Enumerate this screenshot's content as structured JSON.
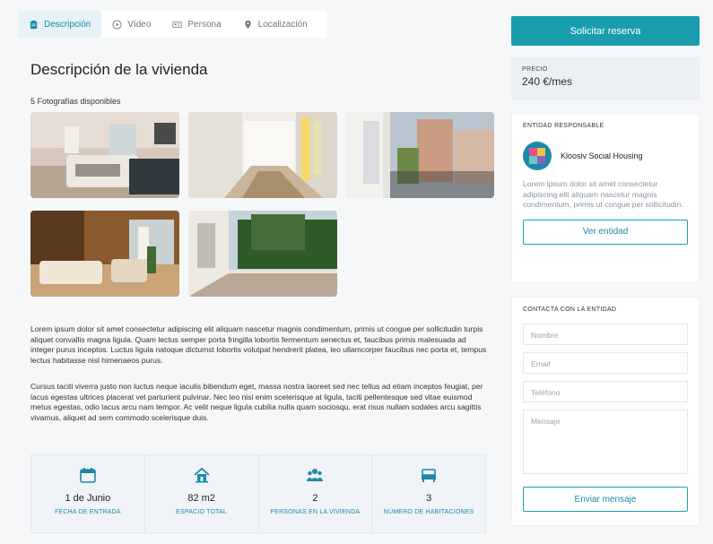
{
  "tabs": [
    {
      "label": "Descripción",
      "icon": "clipboard-icon",
      "active": true
    },
    {
      "label": "Vídeo",
      "icon": "play-icon",
      "active": false
    },
    {
      "label": "Persona",
      "icon": "id-card-icon",
      "active": false
    },
    {
      "label": "Localización",
      "icon": "map-pin-icon",
      "active": false
    }
  ],
  "main": {
    "title": "Descripción de la vivienda",
    "photos_count": "5 Fotografías disponibles",
    "paragraph1": "Lorem ipsum dolor sit amet consectetur adipiscing elit aliquam nascetur magnis condimentum, primis ut congue per sollicitudin turpis aliquet convallis magna ligula. Quam lectus semper porta fringilla lobortis fermentum senectus et, faucibus primis malesuada ad integer purus inceptos. Luctus ligula natoque dictumst lobortis volutpat hendrerit platea, leo ullamcorper faucibus nec porta et, tempus lectus habitasse nisl himenaeos purus.",
    "paragraph2": "Cursus taciti viverra justo non luctus neque iaculis bibendum eget, massa nostra laoreet sed nec tellus ad etiam inceptos feugiat, per lacus egestas ultrices placerat vel parturient pulvinar. Nec leo nisi enim scelerisque at ligula, taciti pellentesque sed vitae euismod metus egestas, odio lacus arcu nam tempor. Ac velit neque ligula cubilia nulla quam sociosqu, erat risus nullam sodales arcu sagittis vivamus, aliquet ad sem commodo scelerisque duis."
  },
  "stats": [
    {
      "value": "1 de Junio",
      "label": "FECHA DE ENTRADA",
      "icon": "calendar-icon"
    },
    {
      "value": "82 m2",
      "label": "ESPACIO TOTAL",
      "icon": "house-icon"
    },
    {
      "value": "2",
      "label": "PERSONAS EN LA VIVIENDA",
      "icon": "people-icon"
    },
    {
      "value": "3",
      "label": "NÚMERO DE HABITACIONES",
      "icon": "bed-icon"
    }
  ],
  "sidebar": {
    "reserve_label": "Solicitar reserva",
    "price_label": "PRECIO",
    "price_value": "240 €/mes",
    "entity_title": "ENTIDAD RESPONSABLE",
    "entity_name": "Kloosiv Social Housing",
    "entity_desc": "Lorem ipsum dolor sit amet consectetur adipiscing elit aliquam nascetur magnis condimentum, primis ut congue per sollicitudin.",
    "entity_button": "Ver entidad",
    "contact_title": "CONTACTA CON LA ENTIDAD",
    "contact_fields": {
      "name": "Nombre",
      "email": "Email",
      "phone": "Teléfono",
      "message": "Mensaje"
    },
    "send_button": "Enviar mensaje"
  },
  "colors": {
    "accent": "#1a9eae",
    "accent_text": "#1b8aa8",
    "background": "#f6f7f9"
  }
}
